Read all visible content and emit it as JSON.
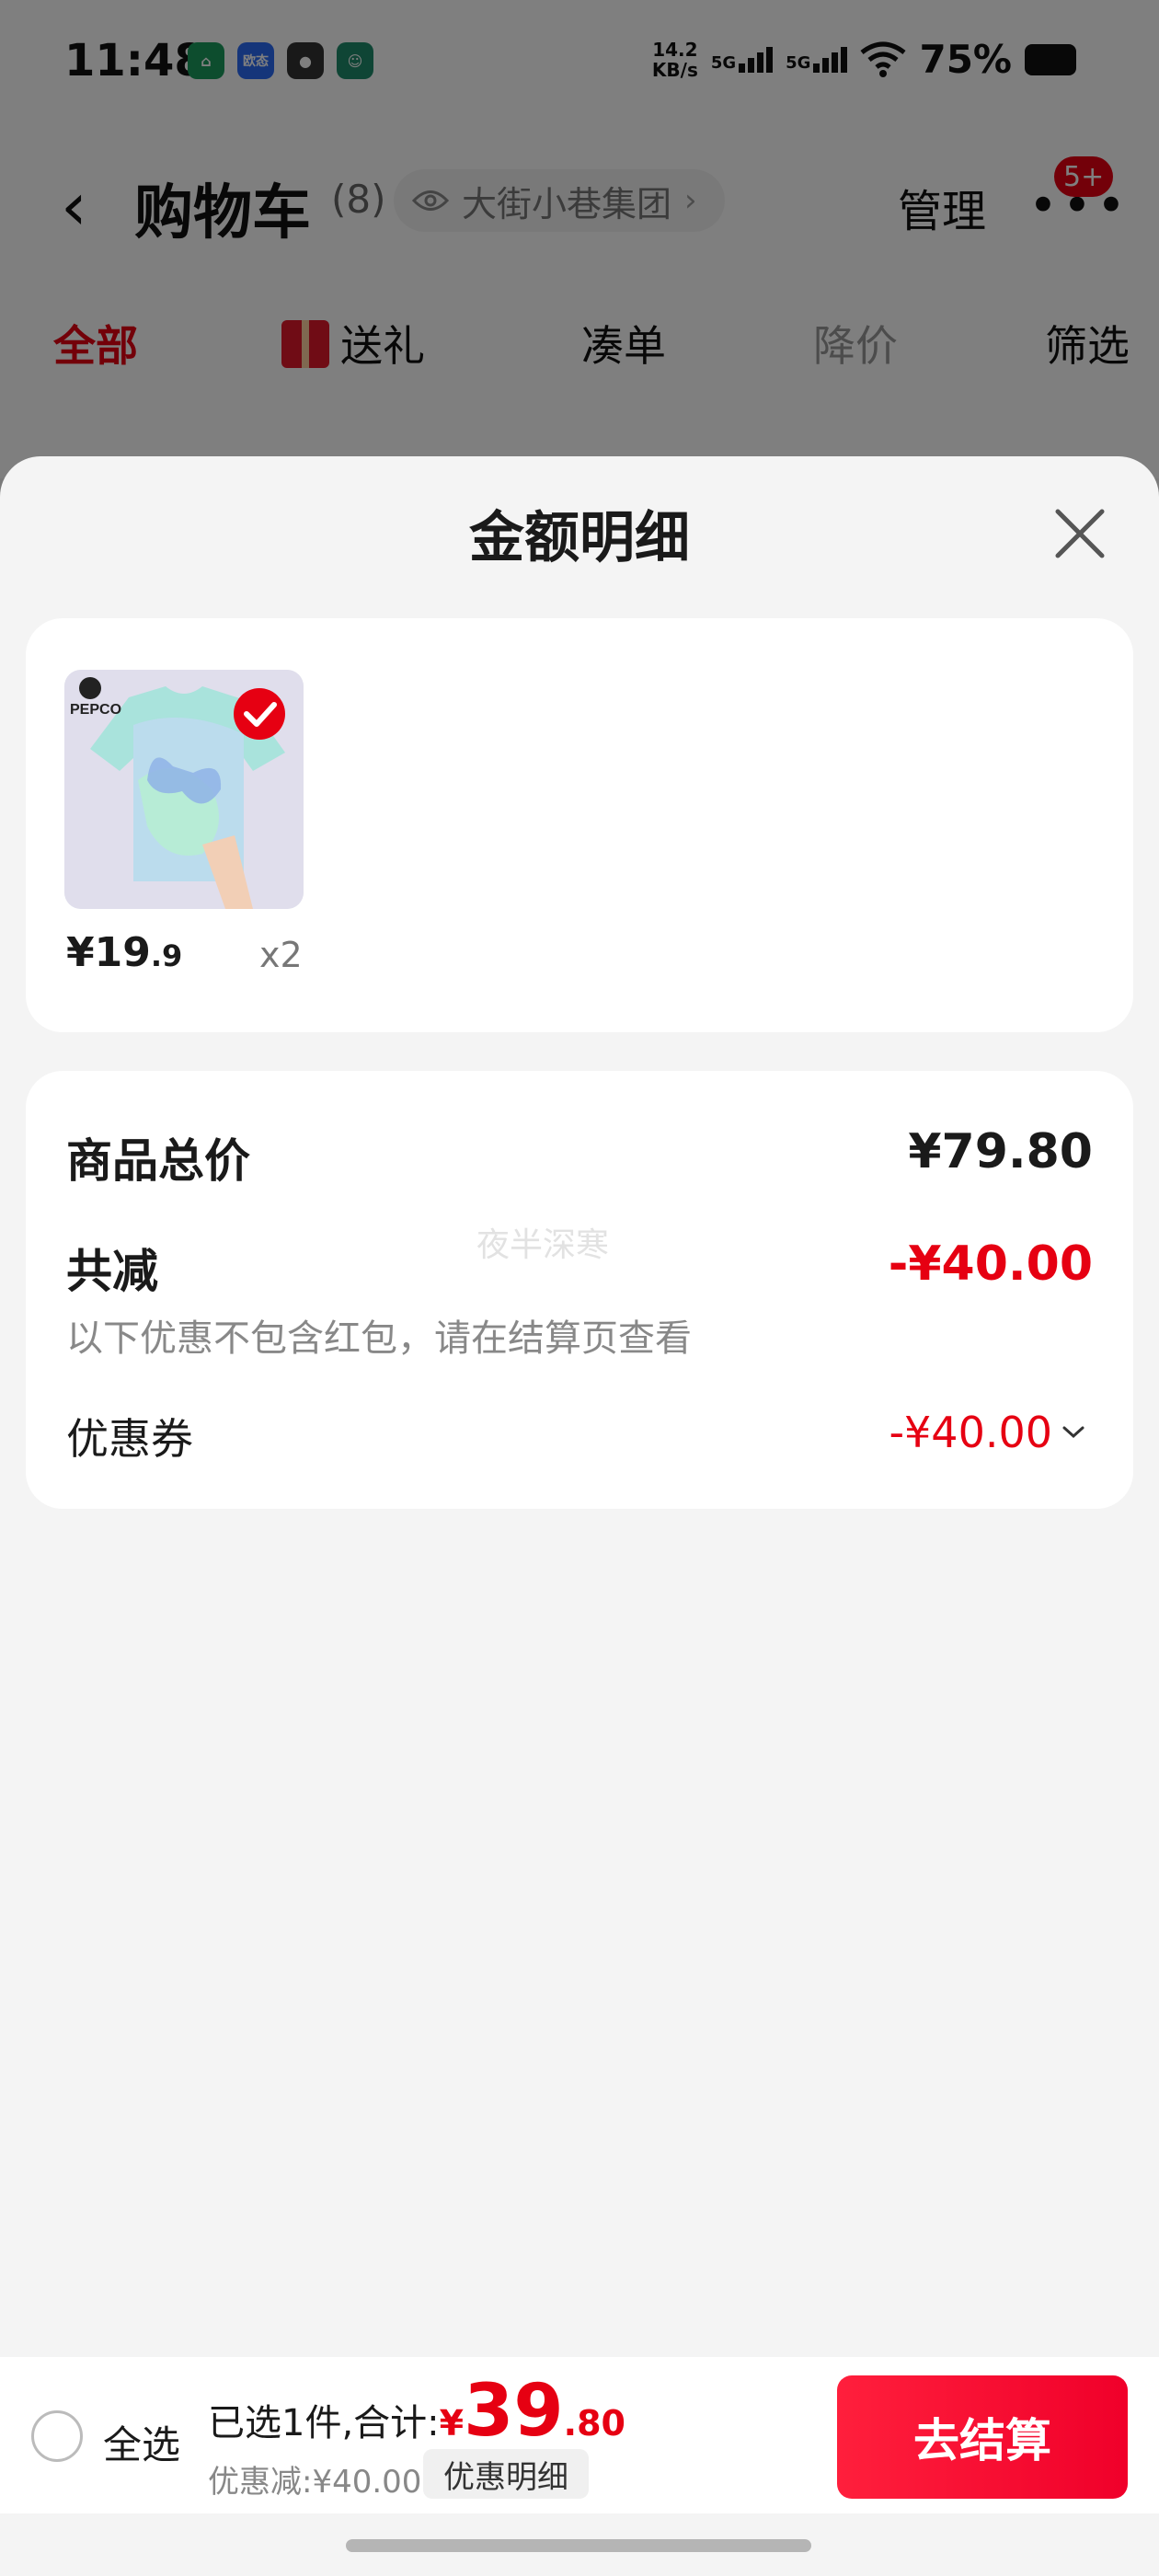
{
  "status_bar": {
    "time": "11:48",
    "apps": [
      {
        "icon": "home-app-icon",
        "label": "⌂",
        "color": "#1a9a5c"
      },
      {
        "icon": "oppo-app-icon",
        "label": "欧态",
        "color": "#2a6af5"
      },
      {
        "icon": "wechat-icon",
        "label": "●",
        "color": "#333333"
      },
      {
        "icon": "avatar-app-icon",
        "label": "☺",
        "color": "#1f8a6a"
      }
    ],
    "net_speed_value": "14.2",
    "net_speed_unit": "KB/s",
    "signal_1": "5G",
    "signal_2": "5G",
    "battery": "75%"
  },
  "nav": {
    "title": "购物车",
    "count": "(8)",
    "shop_name": "大街小巷集团",
    "manage": "管理",
    "badge": "5+"
  },
  "filter_tabs": [
    {
      "label": "全部",
      "state": "active"
    },
    {
      "label": "送礼",
      "state": "normal"
    },
    {
      "label": "凑单",
      "state": "normal"
    },
    {
      "label": "降价",
      "state": "disabled"
    },
    {
      "label": "筛选",
      "state": "normal"
    }
  ],
  "sheet": {
    "title": "金额明细",
    "watermark": "夜半深寒"
  },
  "product": {
    "brand": "PEPCO",
    "price_int": "¥19",
    "price_dec": ".9",
    "qty": "x2",
    "checked": true
  },
  "summary": {
    "total_label": "商品总价",
    "total_value": "¥79.80",
    "discount_label": "共减",
    "discount_value": "-¥40.00",
    "discount_note": "以下优惠不包含红包，请在结算页查看",
    "coupon_label": "优惠券",
    "coupon_value": "-¥40.00"
  },
  "bottom_bar": {
    "select_all": "全选",
    "selected_prefix": "已选1件,合计:",
    "currency": "¥",
    "total_int": "39",
    "total_dec": ".80",
    "discount_text": "优惠减:¥40.00",
    "detail_button": "优惠明细",
    "checkout": "去结算"
  },
  "colors": {
    "accent": "#e60012",
    "sheet_bg": "#f4f4f4",
    "card_bg": "#ffffff"
  }
}
